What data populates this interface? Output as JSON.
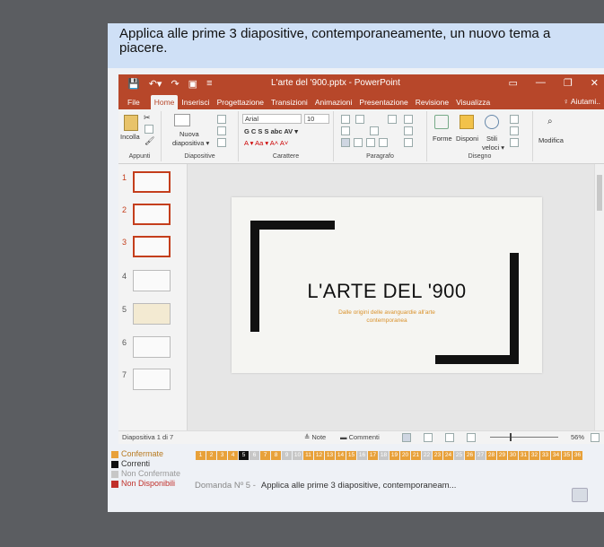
{
  "question": "Applica alle prime 3 diapositive, contemporaneamente, un nuovo tema a piacere.",
  "ppt": {
    "doc_title": "L'arte del '900.pptx - PowerPoint",
    "win_controls": [
      "▭",
      "—",
      "❐",
      "✕"
    ],
    "tabs": [
      "File",
      "Home",
      "Inserisci",
      "Progettazione",
      "Transizioni",
      "Animazioni",
      "Presentazione",
      "Revisione",
      "Visualizza"
    ],
    "active_tab": "Home",
    "help_label": "♀ Aiutami..",
    "ribbon": {
      "paste_label": "Incolla",
      "new_slide_label_1": "Nuova",
      "new_slide_label_2": "diapositiva ▾",
      "font_name": "Arial",
      "font_size": "10",
      "font_buttons": "G  C  S  S  abc  AV ▾",
      "font_color_row": "A ▾  Aa ▾    A˄  A˅",
      "shapes_label": "Forme",
      "arrange_label": "Disponi",
      "styles_label_1": "Stili",
      "styles_label_2": "veloci ▾",
      "edit_label": "Modifica",
      "group_labels": [
        "Appunti",
        "Diapositive",
        "Carattere",
        "Paragrafo",
        "Disegno"
      ]
    },
    "thumbnails": [
      {
        "num": "1",
        "selected": true
      },
      {
        "num": "2",
        "selected": true
      },
      {
        "num": "3",
        "selected": true
      },
      {
        "num": "4",
        "selected": false
      },
      {
        "num": "5",
        "selected": false
      },
      {
        "num": "6",
        "selected": false
      },
      {
        "num": "7",
        "selected": false
      }
    ],
    "slide": {
      "title": "L'ARTE DEL '900",
      "subtitle_1": "Dalle origini delle avanguardie all'arte",
      "subtitle_2": "contemporanea"
    },
    "status": {
      "slide_count": "Diapositiva 1 di 7",
      "notes": "≜ Note",
      "comments": "▬ Commenti",
      "zoom": "56%"
    }
  },
  "legend": [
    {
      "label": "Confermate",
      "color": "#e8a13a"
    },
    {
      "label": "Correnti",
      "color": "#111111"
    },
    {
      "label": "Non Confermate",
      "color": "#c7c7c7"
    },
    {
      "label": "Non Disponibili",
      "color": "#c0302a"
    }
  ],
  "question_numbers": [
    {
      "n": "1",
      "state": "confirmed"
    },
    {
      "n": "2",
      "state": "confirmed"
    },
    {
      "n": "3",
      "state": "confirmed"
    },
    {
      "n": "4",
      "state": "confirmed"
    },
    {
      "n": "5",
      "state": "current"
    },
    {
      "n": "6",
      "state": "unconfirmed"
    },
    {
      "n": "7",
      "state": "confirmed"
    },
    {
      "n": "8",
      "state": "confirmed"
    },
    {
      "n": "9",
      "state": "unconfirmed"
    },
    {
      "n": "10",
      "state": "unconfirmed"
    },
    {
      "n": "11",
      "state": "confirmed"
    },
    {
      "n": "12",
      "state": "confirmed"
    },
    {
      "n": "13",
      "state": "confirmed"
    },
    {
      "n": "14",
      "state": "confirmed"
    },
    {
      "n": "15",
      "state": "confirmed"
    },
    {
      "n": "16",
      "state": "unconfirmed"
    },
    {
      "n": "17",
      "state": "confirmed"
    },
    {
      "n": "18",
      "state": "unconfirmed"
    },
    {
      "n": "19",
      "state": "confirmed"
    },
    {
      "n": "20",
      "state": "confirmed"
    },
    {
      "n": "21",
      "state": "confirmed"
    },
    {
      "n": "22",
      "state": "unconfirmed"
    },
    {
      "n": "23",
      "state": "confirmed"
    },
    {
      "n": "24",
      "state": "confirmed"
    },
    {
      "n": "25",
      "state": "unconfirmed"
    },
    {
      "n": "26",
      "state": "confirmed"
    },
    {
      "n": "27",
      "state": "unconfirmed"
    },
    {
      "n": "28",
      "state": "confirmed"
    },
    {
      "n": "29",
      "state": "confirmed"
    },
    {
      "n": "30",
      "state": "confirmed"
    },
    {
      "n": "31",
      "state": "confirmed"
    },
    {
      "n": "32",
      "state": "confirmed"
    },
    {
      "n": "33",
      "state": "confirmed"
    },
    {
      "n": "34",
      "state": "confirmed"
    },
    {
      "n": "35",
      "state": "confirmed"
    },
    {
      "n": "36",
      "state": "confirmed"
    }
  ],
  "current_question": {
    "number_label": "Domanda Nº 5 -",
    "text": "Applica alle prime 3 diapositive, contemporaneam..."
  }
}
